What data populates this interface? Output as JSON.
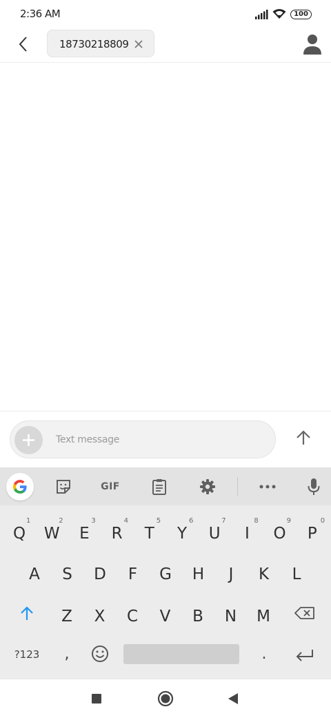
{
  "status_bar": {
    "time": "2:36 AM",
    "battery": "100",
    "icons": [
      "signal-icon",
      "wifi-icon",
      "battery-icon"
    ]
  },
  "header": {
    "back_icon": "chevron-left-icon",
    "recipient": "18730218809",
    "remove_icon": "close-icon",
    "contact_icon": "person-icon"
  },
  "compose": {
    "attach_icon": "plus-icon",
    "placeholder": "Text message",
    "send_icon": "arrow-up-icon"
  },
  "keyboard": {
    "toolbar": {
      "items": [
        "google-icon",
        "sticker-icon",
        "gif",
        "clipboard-icon",
        "gear-icon",
        "more-icon",
        "microphone-icon"
      ],
      "gif_label": "GIF"
    },
    "row1": [
      {
        "char": "Q",
        "hint": "1"
      },
      {
        "char": "W",
        "hint": "2"
      },
      {
        "char": "E",
        "hint": "3"
      },
      {
        "char": "R",
        "hint": "4"
      },
      {
        "char": "T",
        "hint": "5"
      },
      {
        "char": "Y",
        "hint": "6"
      },
      {
        "char": "U",
        "hint": "7"
      },
      {
        "char": "I",
        "hint": "8"
      },
      {
        "char": "O",
        "hint": "9"
      },
      {
        "char": "P",
        "hint": "0"
      }
    ],
    "row2": [
      "A",
      "S",
      "D",
      "F",
      "G",
      "H",
      "J",
      "K",
      "L"
    ],
    "row3": [
      "Z",
      "X",
      "C",
      "V",
      "B",
      "N",
      "M"
    ],
    "symbols_label": "?123",
    "comma": ",",
    "period": ".",
    "shift_icon": "shift-arrow-icon",
    "backspace_icon": "backspace-icon",
    "emoji_icon": "emoji-icon",
    "enter_icon": "enter-icon",
    "accent_color": "#2196F3"
  },
  "nav_bar": {
    "items": [
      "recents-square-icon",
      "home-circle-icon",
      "back-triangle-icon"
    ]
  }
}
